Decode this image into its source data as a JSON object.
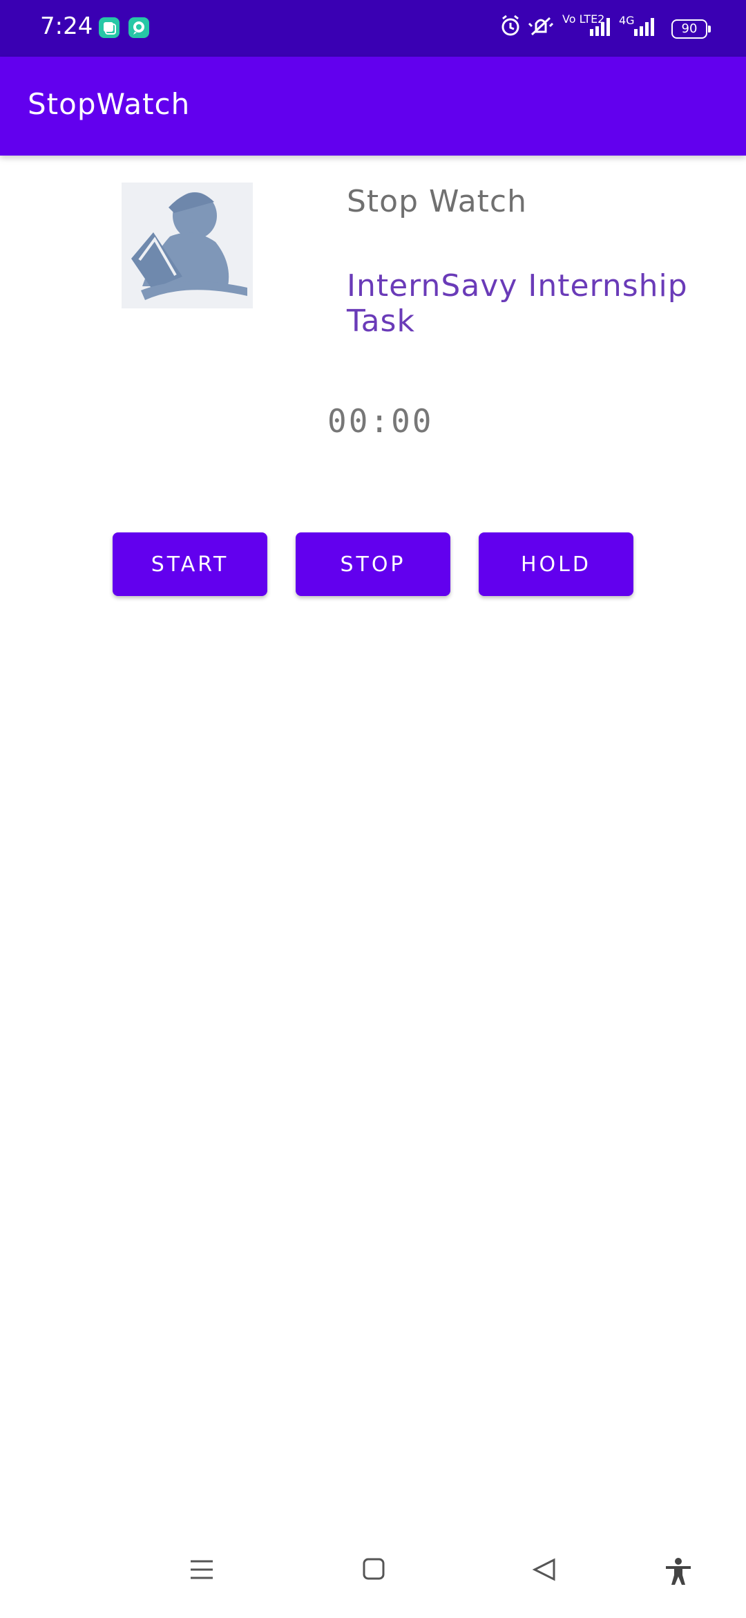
{
  "status_bar": {
    "time": "7:24",
    "battery_level": "90",
    "icons": [
      "app-notification-icon",
      "chat-notification-icon",
      "alarm-icon",
      "silent-bell-icon",
      "volte-icon",
      "signal-icon",
      "4g-icon",
      "signal-icon-2",
      "battery-icon"
    ],
    "volte_label": "Vo LTE2",
    "network_label": "4G"
  },
  "app_bar": {
    "title": "StopWatch",
    "color": "#6200ee"
  },
  "header": {
    "title": "Stop Watch",
    "subtitle": "InternSavy Internship Task",
    "avatar_icon": "reader-icon"
  },
  "timer": {
    "value": "00:00"
  },
  "buttons": {
    "start": "START",
    "stop": "STOP",
    "hold": "HOLD"
  },
  "nav": {
    "icons": [
      "menu-icon",
      "home-icon",
      "back-icon",
      "accessibility-icon"
    ]
  },
  "colors": {
    "status_bar": "#3a00b3",
    "accent": "#6200ee",
    "subtitle": "#6a3bb8",
    "heading": "#707070"
  }
}
